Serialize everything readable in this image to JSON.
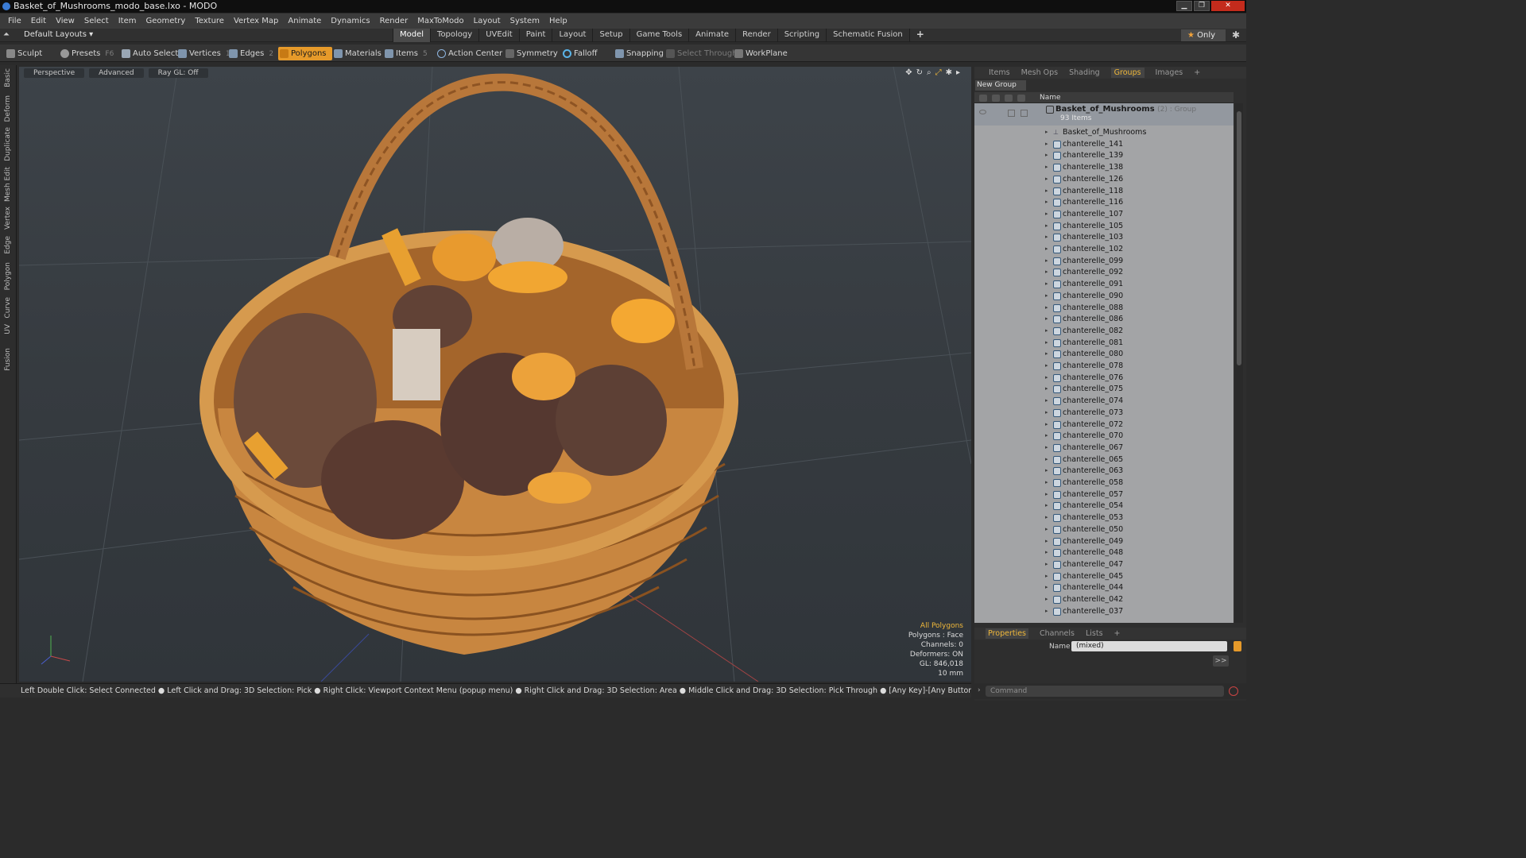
{
  "window": {
    "title": "Basket_of_Mushrooms_modo_base.lxo - MODO"
  },
  "menu": [
    "File",
    "Edit",
    "View",
    "Select",
    "Item",
    "Geometry",
    "Texture",
    "Vertex Map",
    "Animate",
    "Dynamics",
    "Render",
    "MaxToModo",
    "Layout",
    "System",
    "Help"
  ],
  "layoutbar": {
    "default_layouts": "Default Layouts ▾",
    "tabs": [
      "Model",
      "Topology",
      "UVEdit",
      "Paint",
      "Layout",
      "Setup",
      "Game Tools",
      "Animate",
      "Render",
      "Scripting",
      "Schematic Fusion"
    ],
    "active_tab": "Model",
    "only_label": "Only"
  },
  "toolbar": {
    "sculpt": "Sculpt",
    "presets": "Presets",
    "presets_key": "F6",
    "auto_select": "Auto Select",
    "vertices": "Vertices",
    "vertices_key": "1",
    "edges": "Edges",
    "edges_key": "2",
    "polygons": "Polygons",
    "materials": "Materials",
    "items": "Items",
    "items_key": "5",
    "action_center": "Action Center",
    "symmetry": "Symmetry",
    "falloff": "Falloff",
    "snapping": "Snapping",
    "select_through": "Select Through",
    "workplane": "WorkPlane"
  },
  "side_tabs": [
    "Basic",
    "Deform",
    "Duplicate",
    "Mesh Edit",
    "Vertex",
    "Edge",
    "Polygon",
    "Curve",
    "UV",
    "Fusion"
  ],
  "viewport": {
    "view_mode": "Perspective",
    "advanced": "Advanced",
    "raygl": "Ray GL: Off",
    "info": {
      "selection": "All Polygons",
      "polygons": "Polygons : Face",
      "channels": "Channels: 0",
      "deformers": "Deformers: ON",
      "gl": "GL: 846,018",
      "scale": "10 mm"
    }
  },
  "status": "Left Double Click: Select Connected ● Left Click and Drag: 3D Selection: Pick ● Right Click: Viewport Context Menu (popup menu) ● Right Click and Drag: 3D Selection: Area ● Middle Click and Drag: 3D Selection: Pick Through ● [Any Key]-[Any Button] Click and Drag: dragDropBegin",
  "right_panel": {
    "tabs": [
      "Items",
      "Mesh Ops",
      "Shading",
      "Groups",
      "Images"
    ],
    "active_tab": "Groups",
    "new_group": "New Group",
    "column_name": "Name",
    "group": {
      "name": "Basket_of_Mushrooms",
      "suffix": "(2) : Group",
      "count": "93 Items"
    },
    "items": [
      "Basket_of_Mushrooms",
      "chanterelle_141",
      "chanterelle_139",
      "chanterelle_138",
      "chanterelle_126",
      "chanterelle_118",
      "chanterelle_116",
      "chanterelle_107",
      "chanterelle_105",
      "chanterelle_103",
      "chanterelle_102",
      "chanterelle_099",
      "chanterelle_092",
      "chanterelle_091",
      "chanterelle_090",
      "chanterelle_088",
      "chanterelle_086",
      "chanterelle_082",
      "chanterelle_081",
      "chanterelle_080",
      "chanterelle_078",
      "chanterelle_076",
      "chanterelle_075",
      "chanterelle_074",
      "chanterelle_073",
      "chanterelle_072",
      "chanterelle_070",
      "chanterelle_067",
      "chanterelle_065",
      "chanterelle_063",
      "chanterelle_058",
      "chanterelle_057",
      "chanterelle_054",
      "chanterelle_053",
      "chanterelle_050",
      "chanterelle_049",
      "chanterelle_048",
      "chanterelle_047",
      "chanterelle_045",
      "chanterelle_044",
      "chanterelle_042",
      "chanterelle_037"
    ]
  },
  "properties": {
    "tabs": [
      "Properties",
      "Channels",
      "Lists"
    ],
    "active_tab": "Properties",
    "name_label": "Name",
    "name_value": "(mixed)",
    "command_placeholder": "Command"
  },
  "colors": {
    "accent": "#e69a2a",
    "highlight": "#f0b83a",
    "close": "#c42b1c"
  }
}
